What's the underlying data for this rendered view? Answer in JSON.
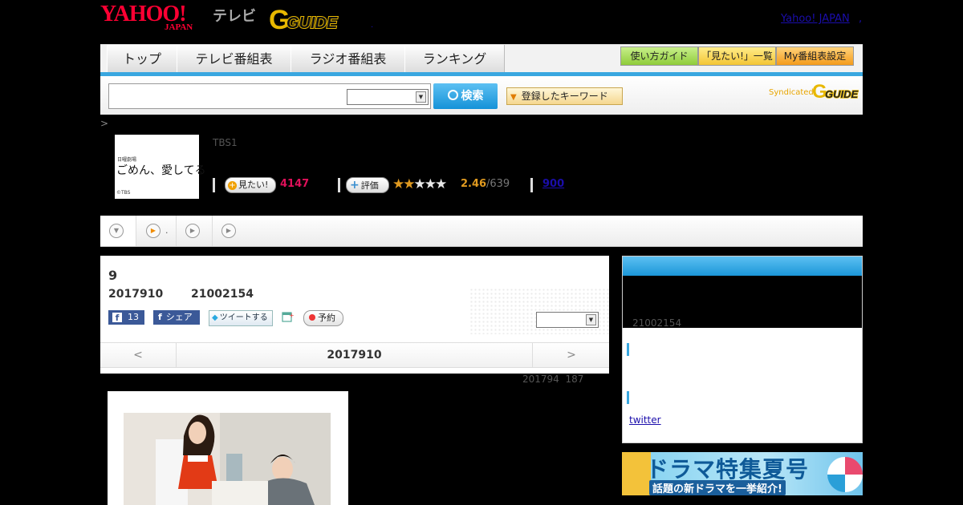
{
  "header": {
    "logo_yahoo": "YAHOO!",
    "logo_japan": "JAPAN",
    "logo_tv": "テレビ",
    "logo_gguide": "GUIDE",
    "yj_link": "Yahoo! JAPAN",
    "yj_dot": ","
  },
  "nav": {
    "tabs": [
      "トップ",
      "テレビ番組表",
      "ラジオ番組表",
      "ランキング"
    ],
    "buttons": [
      "使い方ガイド",
      "「見たい!」一覧",
      "My番組表設定"
    ]
  },
  "search": {
    "button": "検索",
    "keyword_button": "登録したキーワード",
    "syndicated": "Syndicated",
    "syndicated_logo": "GUIDE"
  },
  "breadcrumb": ">",
  "program": {
    "channel": "TBS1",
    "thumb_small": "日曜劇場",
    "thumb_title": "ごめん、愛してる",
    "thumb_credit": "©TBS",
    "want_label": "見たい!",
    "want_count": "4147",
    "rate_label": "評価",
    "rating_stars": 2.46,
    "rating_value": "2.46",
    "rating_count": "/639",
    "comments_link": "900"
  },
  "subnav": {
    "item2_dot": "."
  },
  "episode": {
    "title": "9",
    "date": "2017910",
    "time": "21002154",
    "fb_count": "13",
    "share": "シェア",
    "tweet": "ツイートする",
    "reserve": "予約",
    "prev": "<",
    "next": ">",
    "nav_date": "2017910",
    "updated": "201794  187"
  },
  "sidebar": {
    "time": "21002154",
    "twitter": "twitter"
  },
  "banner": {
    "title": "ドラマ特集夏号",
    "sub": "話題の新ドラマを一挙紹介!"
  },
  "colors": {
    "accent": "#39a7e0",
    "want": "#e0105a",
    "rating": "#e09a20"
  }
}
